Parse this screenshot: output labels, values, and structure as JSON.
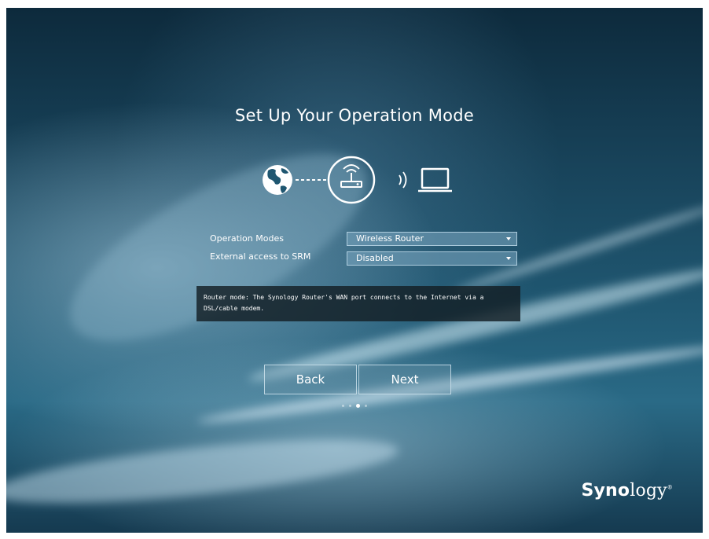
{
  "page": {
    "title": "Set Up Your Operation Mode"
  },
  "diagram": {
    "icons": [
      "globe-icon",
      "router-icon",
      "wireless-signal-icon",
      "laptop-icon"
    ]
  },
  "form": {
    "operation_modes": {
      "label": "Operation Modes",
      "value": "Wireless Router"
    },
    "external_access": {
      "label": "External access to SRM",
      "value": "Disabled"
    }
  },
  "info": {
    "line1": "Router mode: The Synology Router's WAN port connects to the Internet via a",
    "line2": "DSL/cable modem."
  },
  "nav": {
    "back_label": "Back",
    "next_label": "Next",
    "page_indicator": {
      "total": 4,
      "current": 3
    }
  },
  "brand": {
    "logo_bold": "Syno",
    "logo_rest": "logy"
  },
  "colors": {
    "background": "#1f5670",
    "text": "#ffffff",
    "info_box": "#141e24"
  }
}
